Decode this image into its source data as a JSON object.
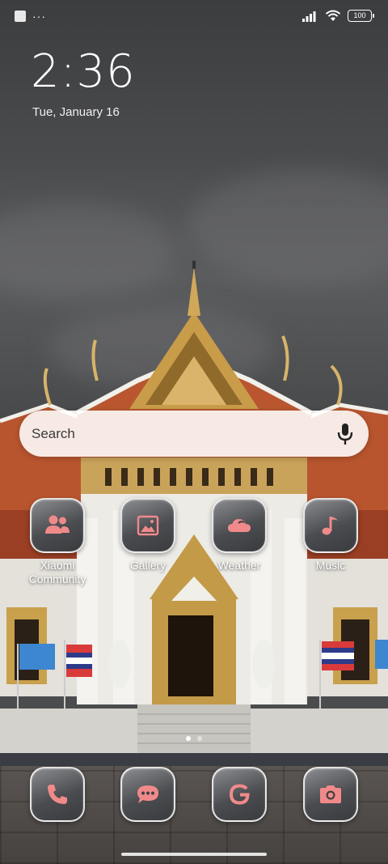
{
  "status_bar": {
    "notif_dots": "···",
    "battery": "100"
  },
  "clock": {
    "time": "2:36",
    "date": "Tue, January 16"
  },
  "search": {
    "label": "Search"
  },
  "apps": [
    {
      "label": "Xiaomi Community",
      "icon": "community-icon"
    },
    {
      "label": "Gallery",
      "icon": "gallery-icon"
    },
    {
      "label": "Weather",
      "icon": "weather-icon"
    },
    {
      "label": "Music",
      "icon": "music-icon"
    }
  ],
  "dock": [
    {
      "icon": "phone-icon"
    },
    {
      "icon": "messages-icon"
    },
    {
      "icon": "google-icon"
    },
    {
      "icon": "camera-icon"
    }
  ],
  "pages": {
    "count": 2,
    "active": 1
  },
  "colors": {
    "icon_accent": "#f08a8a",
    "tile_border": "#ffffff"
  }
}
